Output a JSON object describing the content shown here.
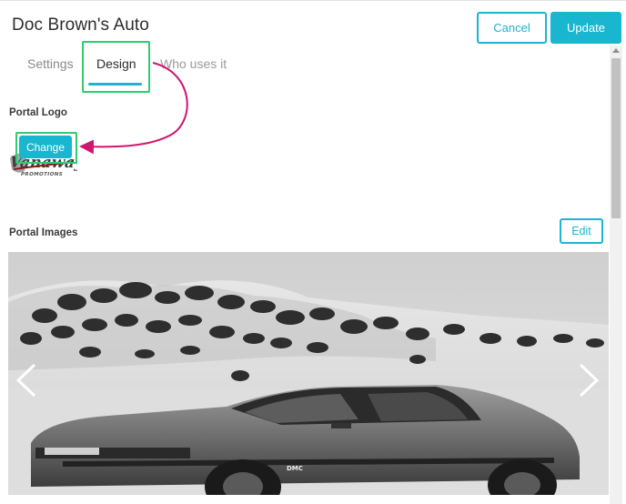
{
  "header": {
    "title": "Doc Brown's Auto",
    "cancel_label": "Cancel",
    "update_label": "Update"
  },
  "tabs": [
    {
      "label": "Settings",
      "active": false
    },
    {
      "label": "Design",
      "active": true
    },
    {
      "label": "Who uses it",
      "active": false
    }
  ],
  "logo_section": {
    "label": "Portal Logo",
    "change_label": "Change",
    "logo_text": "Vanaway",
    "logo_subtext": "PROMOTIONS"
  },
  "images_section": {
    "label": "Portal Images",
    "edit_label": "Edit",
    "car_badge": "DMC"
  },
  "icons": {
    "prev": "chevron-left-icon",
    "next": "chevron-right-icon"
  },
  "colors": {
    "accent": "#19b6cf",
    "highlight": "#2ecc71",
    "annotation_arrow": "#d0166f"
  }
}
